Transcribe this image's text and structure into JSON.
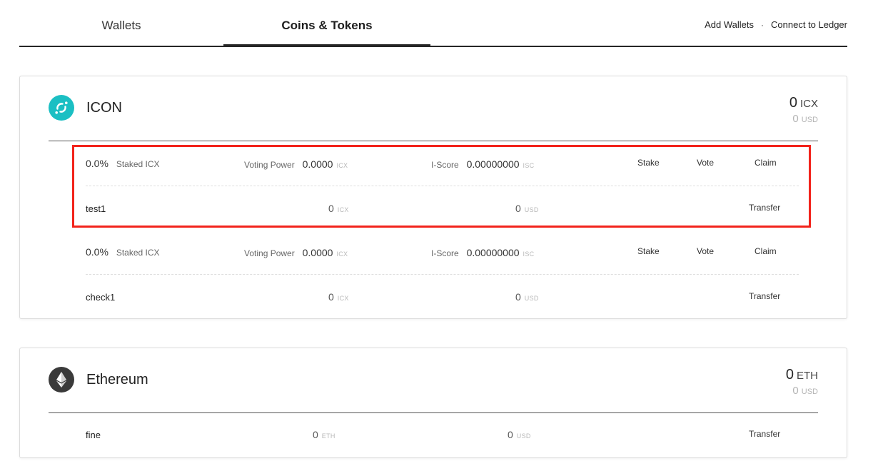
{
  "nav": {
    "tabs": [
      "Wallets",
      "Coins & Tokens"
    ],
    "actions": {
      "add_wallets": "Add Wallets",
      "separator": "·",
      "connect_ledger": "Connect to Ledger"
    }
  },
  "icon_card": {
    "name": "ICON",
    "logo_icon": "icon-logo-icon",
    "total_amount": "0",
    "total_unit": "ICX",
    "total_usd": "0",
    "usd_unit": "USD",
    "wallets": [
      {
        "stake_pct": "0.0%",
        "stake_label": "Staked ICX",
        "vp_label": "Voting Power",
        "vp_value": "0.0000",
        "vp_unit": "ICX",
        "iscore_label": "I-Score",
        "iscore_value": "0.00000000",
        "iscore_unit": "ISC",
        "stake_btn": "Stake",
        "vote_btn": "Vote",
        "claim_btn": "Claim",
        "name": "test1",
        "balance": "0",
        "balance_unit": "ICX",
        "usd": "0",
        "usd_unit": "USD",
        "transfer_btn": "Transfer"
      },
      {
        "stake_pct": "0.0%",
        "stake_label": "Staked ICX",
        "vp_label": "Voting Power",
        "vp_value": "0.0000",
        "vp_unit": "ICX",
        "iscore_label": "I-Score",
        "iscore_value": "0.00000000",
        "iscore_unit": "ISC",
        "stake_btn": "Stake",
        "vote_btn": "Vote",
        "claim_btn": "Claim",
        "name": "check1",
        "balance": "0",
        "balance_unit": "ICX",
        "usd": "0",
        "usd_unit": "USD",
        "transfer_btn": "Transfer"
      }
    ]
  },
  "eth_card": {
    "name": "Ethereum",
    "logo_icon": "ethereum-logo-icon",
    "total_amount": "0",
    "total_unit": "ETH",
    "total_usd": "0",
    "usd_unit": "USD",
    "wallets": [
      {
        "name": "fine",
        "balance": "0",
        "balance_unit": "ETH",
        "usd": "0",
        "usd_unit": "USD",
        "transfer_btn": "Transfer"
      }
    ]
  },
  "colors": {
    "icon_brand": "#1bbfc3",
    "eth_brand": "#3a3a3a",
    "highlight": "#f2231b"
  }
}
